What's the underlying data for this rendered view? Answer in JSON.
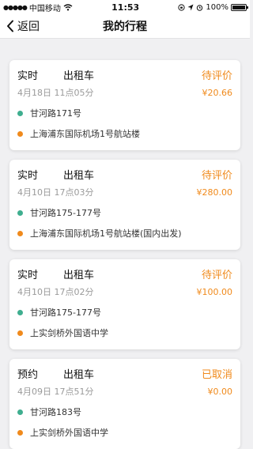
{
  "status_bar": {
    "carrier": "中国移动",
    "time": "11:53",
    "battery": "100%"
  },
  "nav": {
    "back_label": "返回",
    "title": "我的行程"
  },
  "trips": [
    {
      "type": "实时",
      "vehicle": "出租车",
      "status": "待评价",
      "datetime": "4月18日 11点05分",
      "price": "¥20.66",
      "from": "甘河路171号",
      "to": "上海浦东国际机场1号航站楼"
    },
    {
      "type": "实时",
      "vehicle": "出租车",
      "status": "待评价",
      "datetime": "4月10日 17点03分",
      "price": "¥280.00",
      "from": "甘河路175-177号",
      "to": "上海浦东国际机场1号航站楼(国内出发)"
    },
    {
      "type": "实时",
      "vehicle": "出租车",
      "status": "待评价",
      "datetime": "4月10日 17点02分",
      "price": "¥100.00",
      "from": "甘河路175-177号",
      "to": "上实剑桥外国语中学"
    },
    {
      "type": "预约",
      "vehicle": "出租车",
      "status": "已取消",
      "datetime": "4月09日 17点51分",
      "price": "¥0.00",
      "from": "甘河路183号",
      "to": "上实剑桥外国语中学"
    }
  ],
  "colors": {
    "accent": "#f08a1c",
    "start_dot": "#3fae8f",
    "end_dot": "#f08a1c"
  }
}
